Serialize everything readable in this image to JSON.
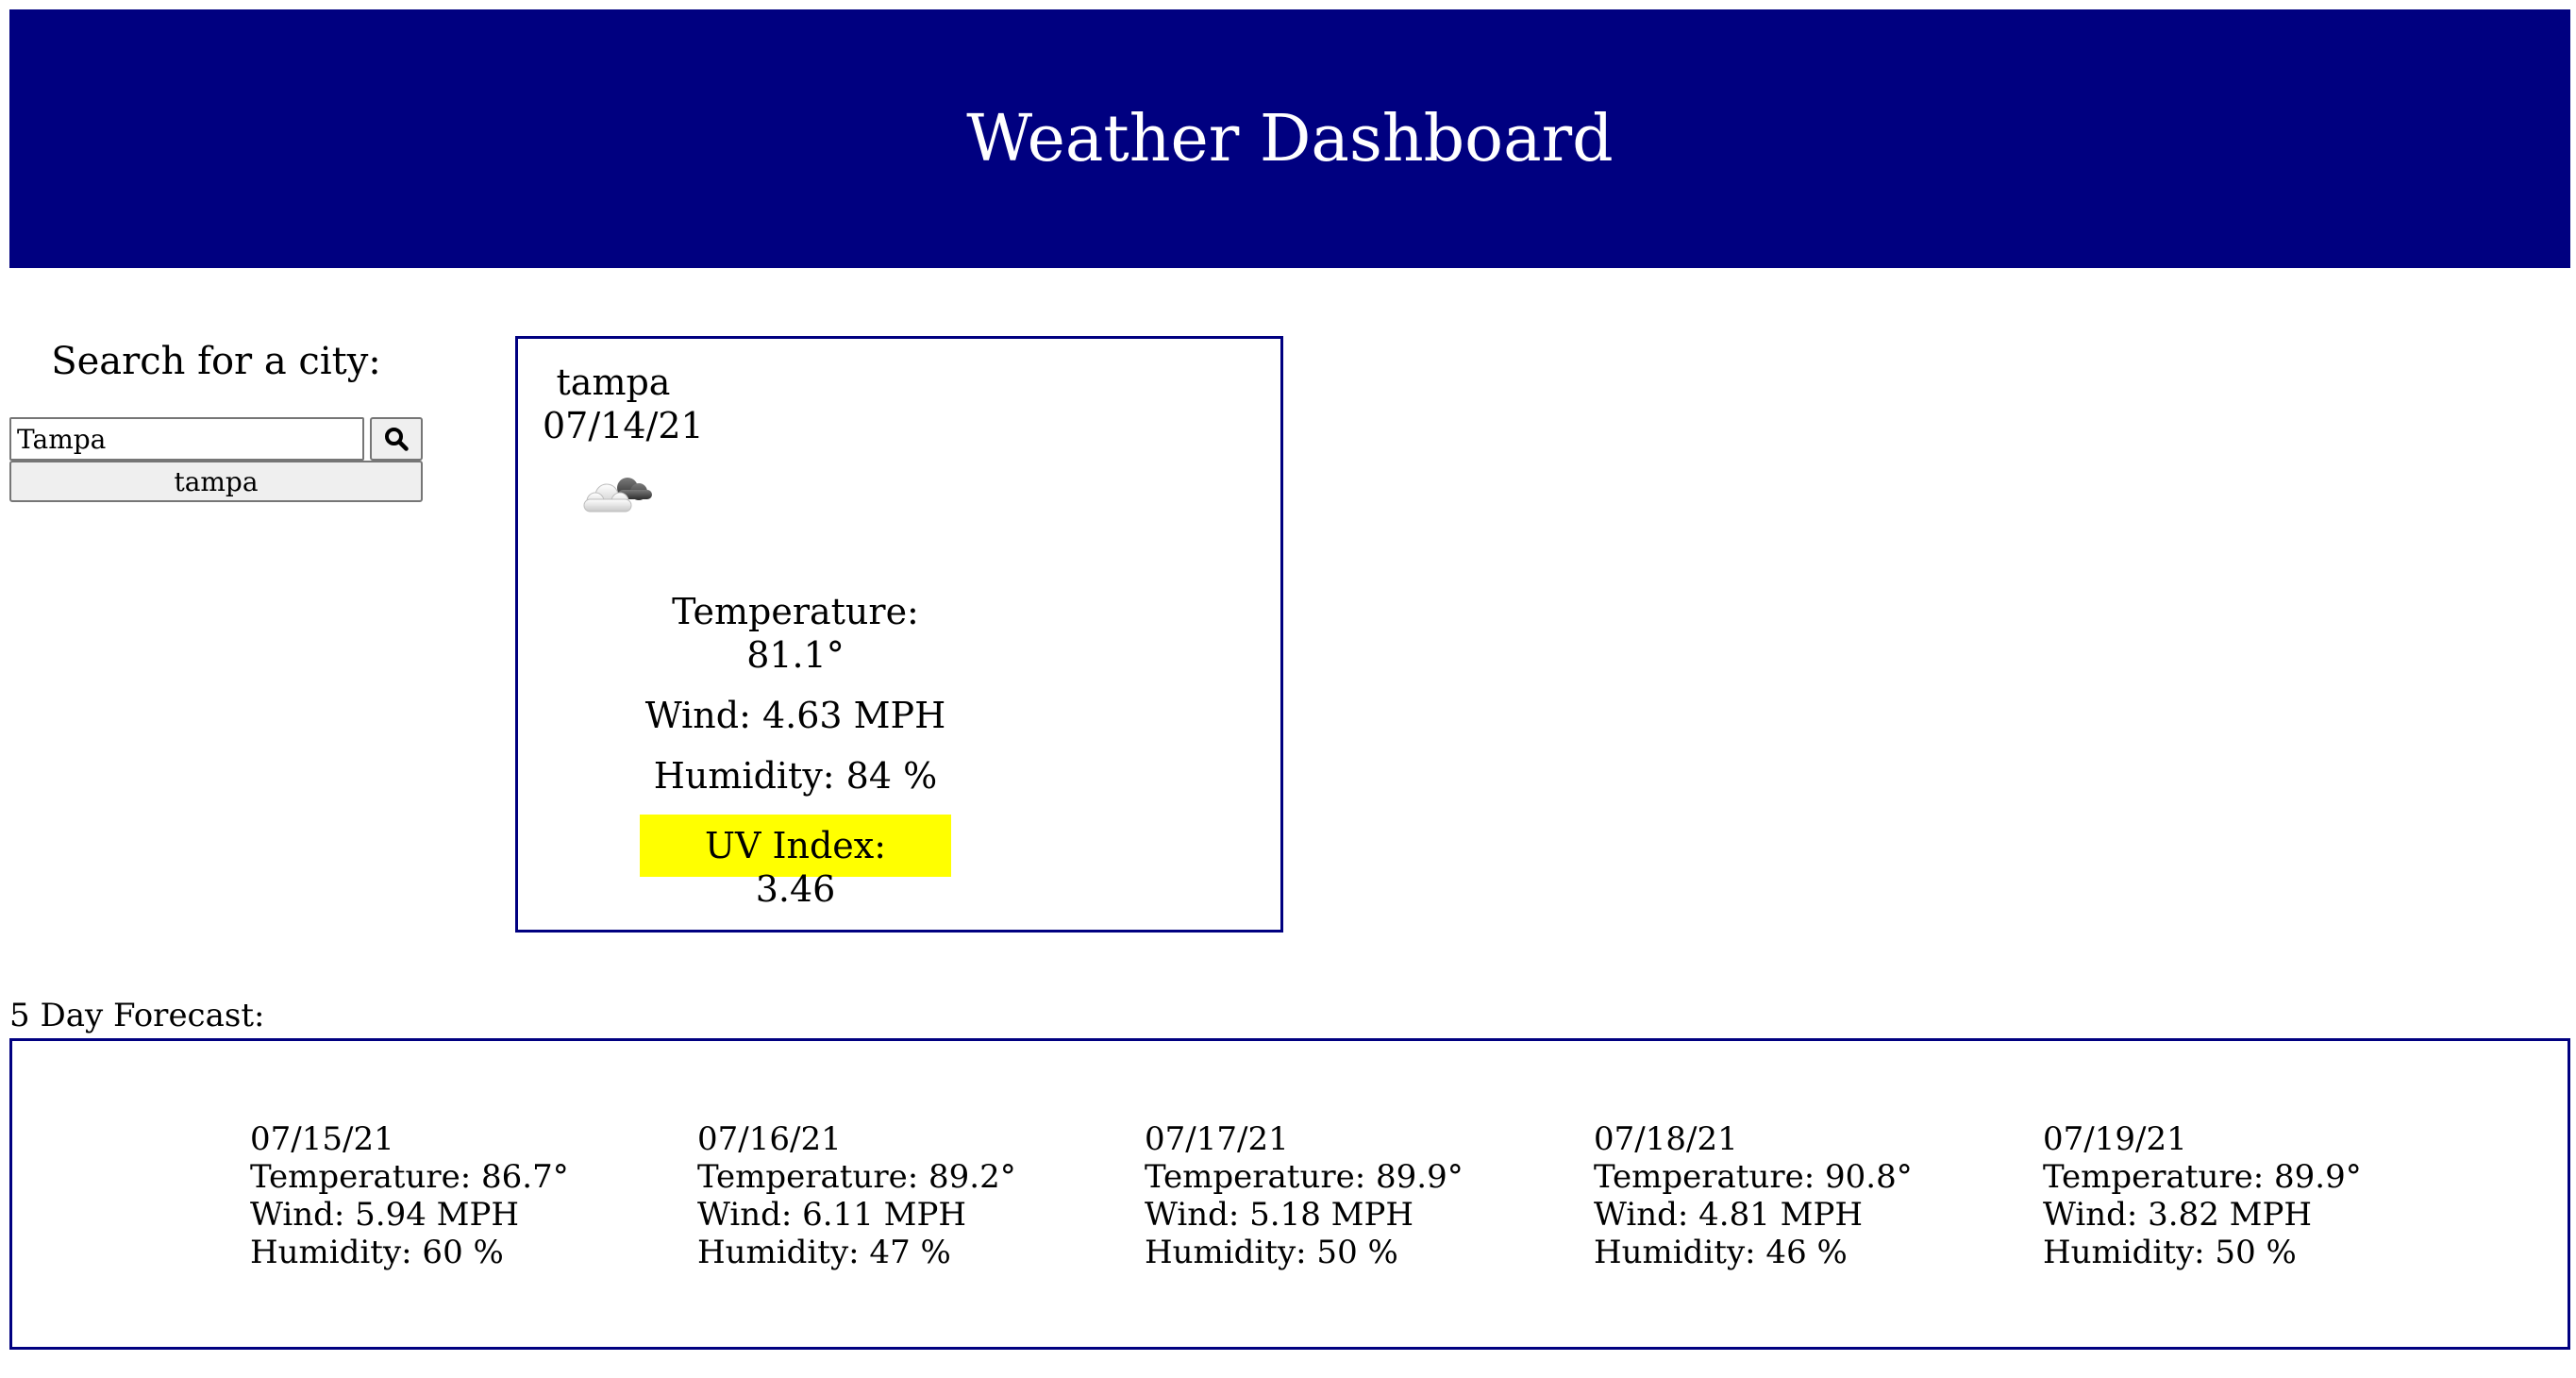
{
  "colors": {
    "header_bg": "#000080",
    "border": "#000080",
    "uv_bg": "#ffff00"
  },
  "header": {
    "title": "Weather Dashboard"
  },
  "search": {
    "heading": "Search for a city:",
    "input_value": "Tampa",
    "search_icon": "search-icon",
    "history": [
      "tampa"
    ]
  },
  "current": {
    "city": "tampa",
    "date": "07/14/21",
    "icon": "cloud-icon",
    "temperature_label": "Temperature:",
    "temperature_value": "81.1°",
    "wind": "Wind: 4.63 MPH",
    "humidity": "Humidity: 84 %",
    "uv": "UV Index: 3.46"
  },
  "forecast": {
    "label": "5 Day Forecast:",
    "days": [
      {
        "date": "07/15/21",
        "temp": "Temperature: 86.7°",
        "wind": "Wind: 5.94 MPH",
        "humidity": "Humidity: 60 %"
      },
      {
        "date": "07/16/21",
        "temp": "Temperature: 89.2°",
        "wind": "Wind: 6.11 MPH",
        "humidity": "Humidity: 47 %"
      },
      {
        "date": "07/17/21",
        "temp": "Temperature: 89.9°",
        "wind": "Wind: 5.18 MPH",
        "humidity": "Humidity: 50 %"
      },
      {
        "date": "07/18/21",
        "temp": "Temperature: 90.8°",
        "wind": "Wind: 4.81 MPH",
        "humidity": "Humidity: 46 %"
      },
      {
        "date": "07/19/21",
        "temp": "Temperature: 89.9°",
        "wind": "Wind: 3.82 MPH",
        "humidity": "Humidity: 50 %"
      }
    ]
  }
}
